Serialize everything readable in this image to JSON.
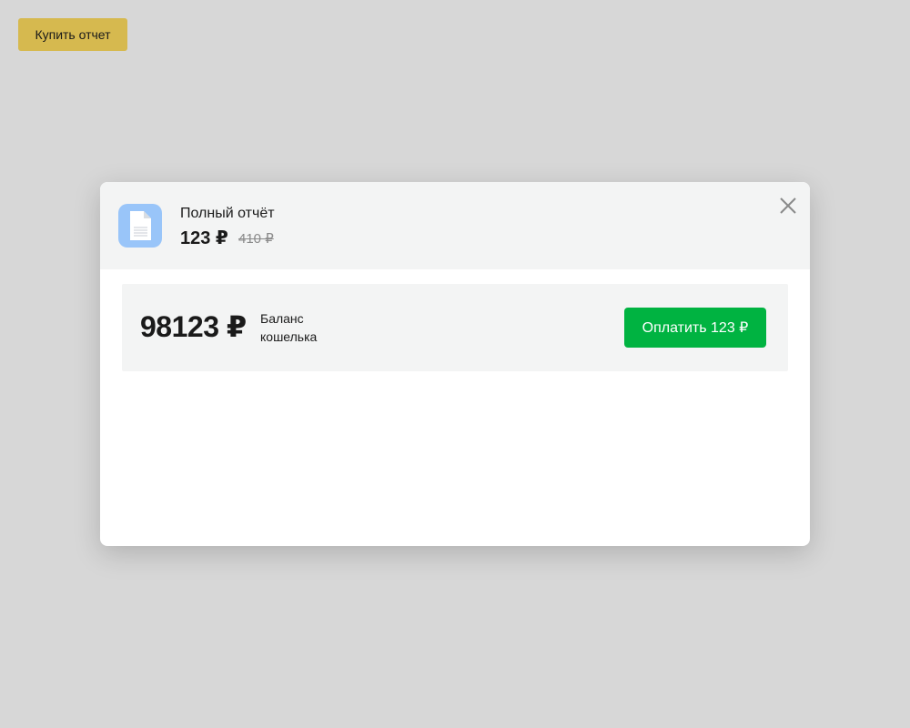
{
  "buy_button": {
    "label": "Купить отчет"
  },
  "modal": {
    "product": {
      "icon": "document-icon",
      "title": "Полный отчёт",
      "price": "123 ₽",
      "old_price": "410 ₽"
    },
    "close_icon": "close-icon",
    "wallet": {
      "balance": "98123 ₽",
      "label": "Баланс кошелька"
    },
    "pay_button": {
      "label": "Оплатить 123 ₽"
    }
  },
  "colors": {
    "background": "#d7d7d7",
    "buy_button": "#d6b94f",
    "pay_button": "#00b341",
    "icon_background": "#99c5f9",
    "header_background": "#f3f4f4"
  }
}
